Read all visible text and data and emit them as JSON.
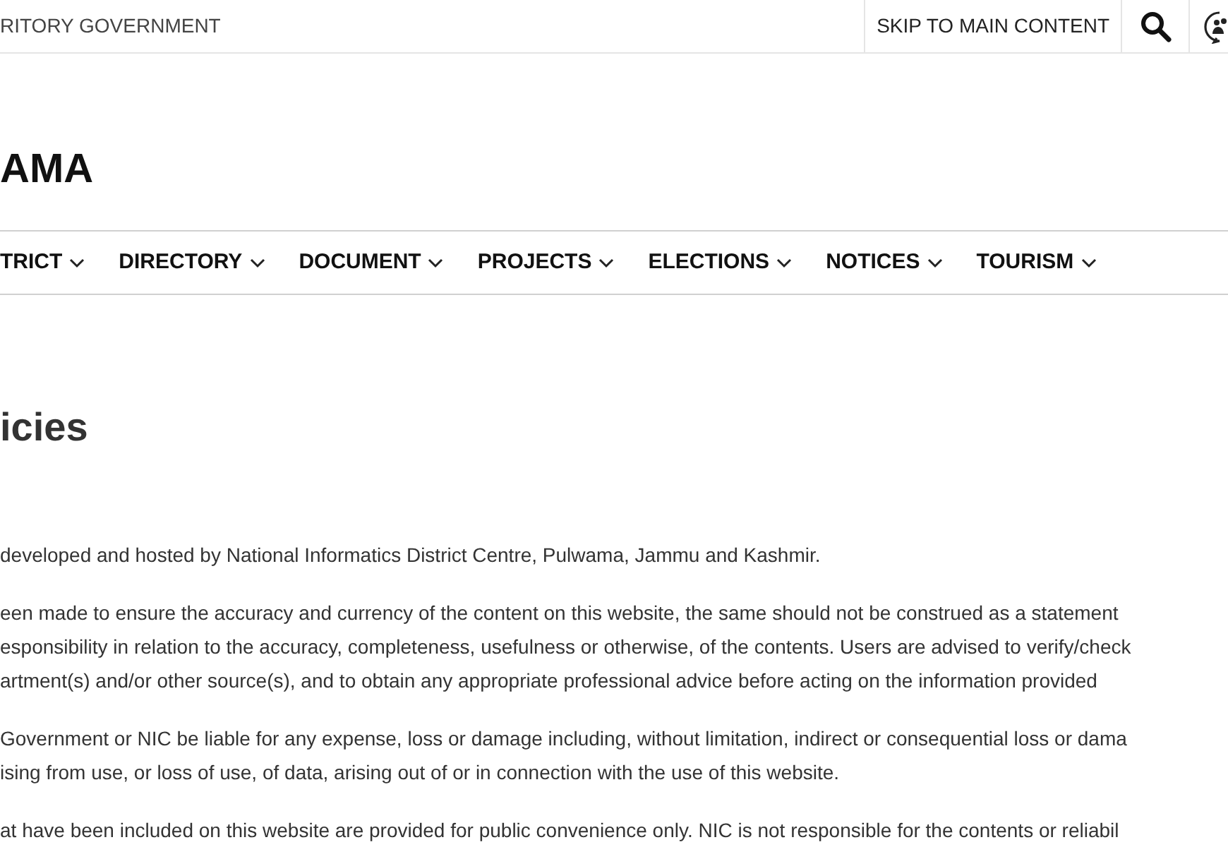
{
  "top_bar": {
    "government_label": "RITORY GOVERNMENT",
    "skip_link": "SKIP TO MAIN CONTENT"
  },
  "site_title": "AMA",
  "nav": [
    {
      "label": "TRICT"
    },
    {
      "label": "DIRECTORY"
    },
    {
      "label": "DOCUMENT"
    },
    {
      "label": "PROJECTS"
    },
    {
      "label": "ELECTIONS"
    },
    {
      "label": "NOTICES"
    },
    {
      "label": "TOURISM"
    }
  ],
  "page_title": "icies",
  "paragraphs": [
    [
      "developed and hosted by National Informatics District Centre, Pulwama, Jammu and Kashmir."
    ],
    [
      "een made to ensure the accuracy and currency of the content on this website, the same should not be construed as a statement",
      "esponsibility in relation to the accuracy, completeness, usefulness or otherwise, of the contents. Users are advised to verify/check",
      "artment(s) and/or other source(s), and to obtain any appropriate professional advice before acting on the information provided"
    ],
    [
      "Government or NIC be liable for any expense, loss or damage including, without limitation, indirect or consequential loss or dama",
      "ising from use, or loss of use, of data, arising out of or in connection with the use of this website."
    ],
    [
      "at have been included on this website are provided for public convenience only. NIC is not responsible for the contents or reliabil"
    ]
  ]
}
